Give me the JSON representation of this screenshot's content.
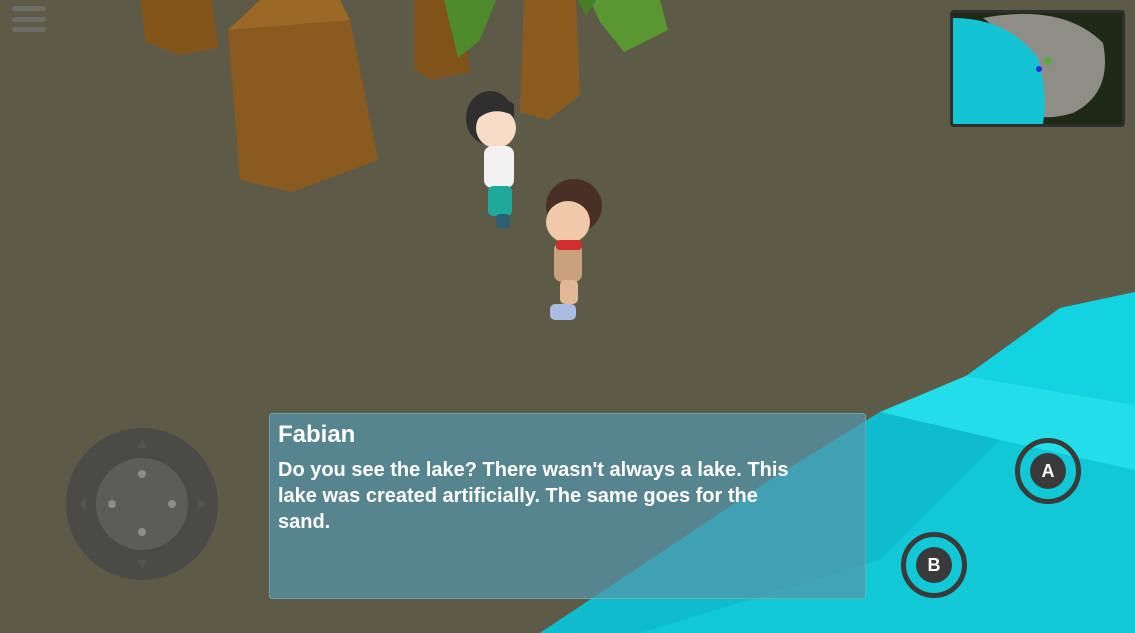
{
  "dialog": {
    "speaker": "Fabian",
    "text": "Do you see the lake? There wasn't always a lake. This\nlake was created artificially. The same goes for the\nsand."
  },
  "controls": {
    "a_label": "A",
    "b_label": "B"
  },
  "icons": {
    "menu": "hamburger-menu-icon",
    "joystick": "virtual-joystick-dpad"
  },
  "colors": {
    "ground": "#5e5a48",
    "water": "#10c8d6",
    "tree_trunk": "#8a5a1e",
    "leaves": "#4f8a2c",
    "dialog_bg": "#5596aa",
    "button": "#3a3a3a"
  }
}
